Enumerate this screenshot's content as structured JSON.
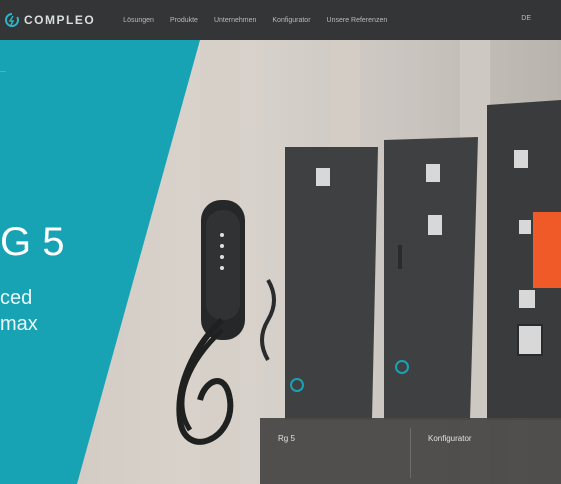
{
  "brand": {
    "name": "COMPLEO"
  },
  "nav": {
    "items": [
      "Lösungen",
      "Produkte",
      "Unternehmen",
      "Konfigurator",
      "Unsere Referenzen"
    ],
    "lang": "DE"
  },
  "hero": {
    "breadcrumb": "...",
    "headline": "G 5",
    "sub_lines": [
      "ced",
      "max"
    ]
  },
  "infobox": {
    "left_title": "Rg 5",
    "right_title": "Konfigurator",
    "left_desc": "",
    "right_desc": ""
  },
  "colors": {
    "topbar": "#333536",
    "teal": "#18a3b5",
    "orange": "#f05a28",
    "dark": "#3f4041"
  }
}
